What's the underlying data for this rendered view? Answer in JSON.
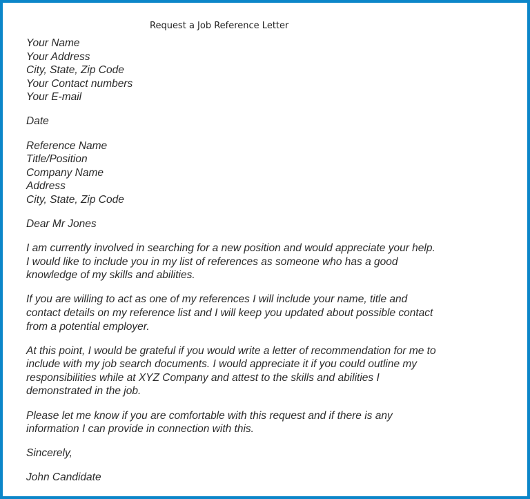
{
  "document": {
    "title": "Request a Job Reference Letter",
    "sender_block": [
      "Your Name",
      "Your Address",
      "City, State, Zip Code",
      "Your Contact numbers",
      "Your E-mail"
    ],
    "date": "Date",
    "recipient_block": [
      "Reference Name",
      "Title/Position",
      "Company Name",
      "Address",
      "City, State, Zip Code"
    ],
    "salutation": "Dear Mr Jones",
    "paragraphs": [
      [
        "I am currently involved in searching for a new position and would appreciate your help.",
        "I would like to include you in my list of references as someone who has a good",
        "knowledge of my skills and abilities."
      ],
      [
        "If you are willing to act as one of my references I will include your name, title and",
        "contact details on my reference list and I will keep you updated about possible contact",
        "from a potential employer."
      ],
      [
        "At this point, I would be grateful if you would write a letter of recommendation for me to",
        "include with my job search documents. I would appreciate it if you could outline my",
        "responsibilities while at XYZ Company and attest to the skills and abilities I",
        "demonstrated in the job."
      ],
      [
        "Please let me know if you are comfortable with this request and if there is any",
        "information I can provide in connection with this."
      ]
    ],
    "closing": "Sincerely,",
    "signature": "John Candidate"
  },
  "colors": {
    "border": "#0b86c9",
    "text": "#2a2a2a"
  }
}
